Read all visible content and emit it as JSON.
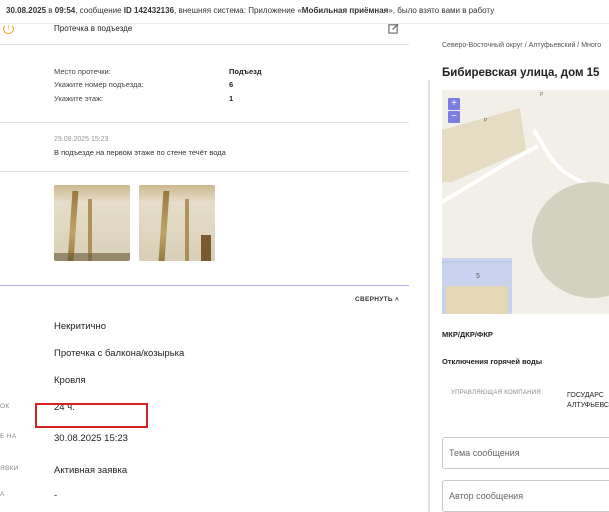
{
  "topbar": {
    "date": "30.08.2025",
    "in_word": "в",
    "time": "09:54",
    "msg_prefix": ", сообщение",
    "msg_id": "ID 142432136",
    "system_text": ", внешняя система: Приложение «",
    "app_name": "Мобильная приёмная",
    "suffix": "», было взято вами в работу"
  },
  "issue": {
    "title": "Протечка в подъезде",
    "details": [
      {
        "label": "Место протечки:",
        "value": "Подъезд"
      },
      {
        "label": "Укажите номер подъезда:",
        "value": "6"
      },
      {
        "label": "Укажите этаж:",
        "value": "1"
      }
    ],
    "comment": {
      "date": "29.08.2025 15:23",
      "text": "В подъезде на первом этаже по стене течёт вода"
    }
  },
  "collapse_label": "СВЕРНУТЬ",
  "fields": [
    {
      "label": "",
      "value": "Некритично"
    },
    {
      "label": "",
      "value": "Протечка с балкона/козырька"
    },
    {
      "label": "",
      "value": "Кровля"
    },
    {
      "label": "ОК",
      "value": "24 ч."
    },
    {
      "label": "Е НА",
      "value": "30.08.2025 15:23"
    },
    {
      "label": "ЯВКИ",
      "value": "Активная заявка"
    },
    {
      "label": "А",
      "value": "-"
    }
  ],
  "right": {
    "breadcrumb": "Северо-Восточный округ / Алтуфьевский / Много",
    "address": "Бибиревская улица, дом 15",
    "map": {
      "zoom_in": "+",
      "zoom_out": "−",
      "building_number": "5",
      "poi1": "P",
      "poi2": "P"
    },
    "district_label": "МКР/ДКР/ФКР",
    "hot_water_label": "Отключения горячей воды",
    "uk_label": "УПРАВЛЯЮЩАЯ КОМПАНИЯ",
    "uk_value": "ГОСУДАРС АЛТУФЬЕВС",
    "subject_placeholder": "Тема сообщения",
    "author_placeholder": "Автор сообщения"
  },
  "colors": {
    "accent": "#7b7ee0",
    "highlight": "#d32222",
    "warning": "#f0a020",
    "separator": "#b8aee8"
  }
}
